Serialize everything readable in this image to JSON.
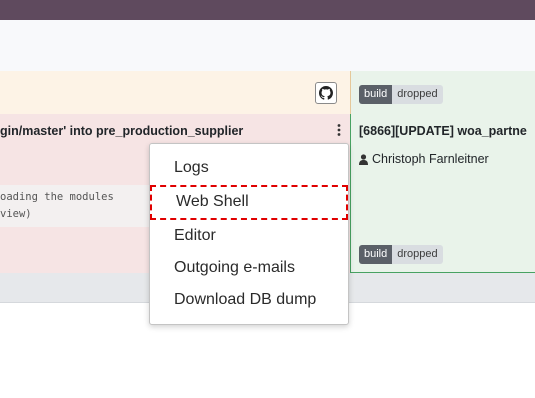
{
  "header": {},
  "builds": {
    "left": {
      "commit_title": "gin/master' into pre_production_supplier",
      "log_lines": [
        "oading the modules",
        "view)"
      ]
    },
    "right": {
      "commit_title": "[6866][UPDATE] woa_partne",
      "author": "Christoph Farnleitner",
      "top_badge": {
        "label": "build",
        "status": "dropped"
      },
      "bottom_badge": {
        "label": "build",
        "status": "dropped"
      }
    }
  },
  "context_menu": {
    "items": [
      "Logs",
      "Web Shell",
      "Editor",
      "Outgoing e-mails",
      "Download DB dump"
    ],
    "highlighted": "Web Shell"
  },
  "icons": {
    "github": "github-icon",
    "kebab": "vertical-ellipsis-icon",
    "user": "user-icon"
  },
  "colors": {
    "topbar": "#5f4a5e",
    "failed_bg": "#f6e4e4",
    "success_bg": "#e9f3ea",
    "highlight": "#e00000"
  }
}
